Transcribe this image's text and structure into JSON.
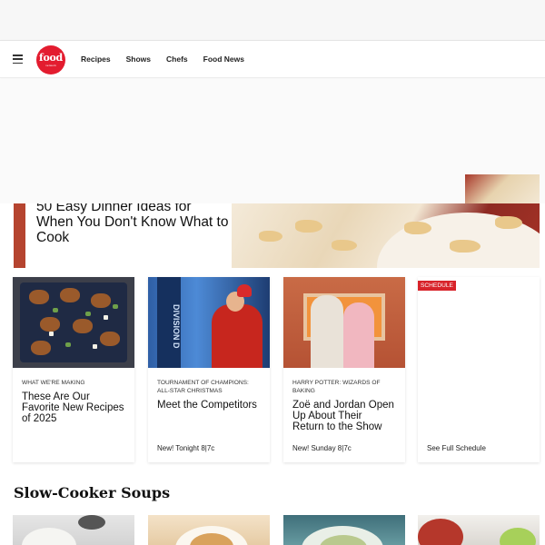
{
  "nav": {
    "logo_text": "food",
    "logo_subtext": "network",
    "links": [
      "Recipes",
      "Shows",
      "Chefs",
      "Food News"
    ]
  },
  "hero": {
    "title": "50 Easy Dinner Ideas for When You Don't Know What to Cook"
  },
  "cards": [
    {
      "kicker": "WHAT WE'RE MAKING",
      "title": "These Are Our Favorite New Recipes of 2025",
      "footer": ""
    },
    {
      "kicker": "TOURNAMENT OF CHAMPIONS: ALL-STAR CHRISTMAS",
      "title": "Meet the Competitors",
      "footer": "New! Tonight 8|7c"
    },
    {
      "kicker": "HARRY POTTER: WIZARDS OF BAKING",
      "title": "Zoë and Jordan Open Up About Their Return to the Show",
      "footer": "New! Sunday 8|7c"
    },
    {
      "badge": "SCHEDULE",
      "footer": "See Full Schedule"
    }
  ],
  "card2_sign_text": "DIVISION D",
  "section": {
    "title": "Slow-Cooker Soups"
  },
  "icons": [
    "hamburger-menu-icon",
    "food-network-logo"
  ],
  "colors": {
    "brand_red": "#e31c2f",
    "schedule_badge": "#d8232a"
  }
}
